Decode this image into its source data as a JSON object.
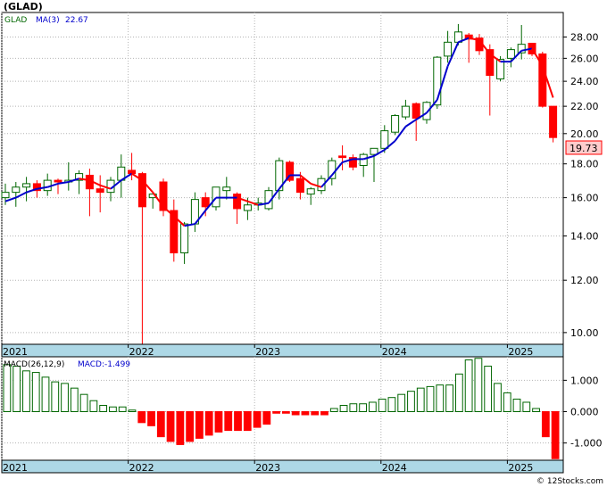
{
  "title": "(GLAD)",
  "credit": "© 12Stocks.com",
  "colors": {
    "up": "#006600",
    "down": "#ff0000",
    "ma_up": "#0000cc",
    "ma_down": "#ff0000",
    "axis_band": "#add8e6",
    "grid": "#b4b4b4"
  },
  "price_legend": {
    "symbol": "GLAD",
    "ma_label": "MA(3)",
    "ma_value": "22.67"
  },
  "last_price_label": "19.73",
  "macd_legend": {
    "label": "MACD(26,12,9)",
    "value_label": "MACD:-1.499"
  },
  "chart_data": [
    {
      "type": "candlestick",
      "scale": "log",
      "ylim": [
        9.6,
        30.5
      ],
      "yticks": [
        10,
        12,
        14,
        16,
        18,
        20,
        22,
        24,
        26,
        28
      ],
      "ytick_labels": [
        "10.00",
        "12.00",
        "14.00",
        "16.00",
        "18.00",
        "20.00",
        "22.00",
        "24.00",
        "26.00",
        "28.00"
      ],
      "x_labels": [
        {
          "text": "2021",
          "month": 0
        },
        {
          "text": "2022",
          "month": 12
        },
        {
          "text": "2023",
          "month": 24
        },
        {
          "text": "2024",
          "month": 36
        },
        {
          "text": "2025",
          "month": 48
        }
      ],
      "grid": true,
      "candles": [
        {
          "m": 0,
          "o": 16.0,
          "h": 16.8,
          "l": 15.6,
          "c": 16.3
        },
        {
          "m": 1,
          "o": 16.3,
          "h": 16.9,
          "l": 15.5,
          "c": 16.6
        },
        {
          "m": 2,
          "o": 16.6,
          "h": 17.2,
          "l": 15.8,
          "c": 16.8
        },
        {
          "m": 3,
          "o": 16.8,
          "h": 17.0,
          "l": 16.0,
          "c": 16.4
        },
        {
          "m": 4,
          "o": 16.4,
          "h": 17.4,
          "l": 16.1,
          "c": 17.0
        },
        {
          "m": 5,
          "o": 17.0,
          "h": 17.1,
          "l": 16.2,
          "c": 16.9
        },
        {
          "m": 6,
          "o": 16.9,
          "h": 18.1,
          "l": 16.4,
          "c": 17.0
        },
        {
          "m": 7,
          "o": 17.0,
          "h": 17.6,
          "l": 16.2,
          "c": 17.4
        },
        {
          "m": 8,
          "o": 17.3,
          "h": 17.7,
          "l": 15.0,
          "c": 16.5
        },
        {
          "m": 9,
          "o": 16.5,
          "h": 17.3,
          "l": 15.2,
          "c": 16.3
        },
        {
          "m": 10,
          "o": 16.3,
          "h": 17.2,
          "l": 15.8,
          "c": 17.0
        },
        {
          "m": 11,
          "o": 17.0,
          "h": 18.6,
          "l": 16.0,
          "c": 17.8
        },
        {
          "m": 12,
          "o": 17.6,
          "h": 18.7,
          "l": 17.0,
          "c": 17.4
        },
        {
          "m": 13,
          "o": 17.4,
          "h": 17.5,
          "l": 9.6,
          "c": 15.5
        },
        {
          "m": 14,
          "o": 16.0,
          "h": 16.2,
          "l": 15.4,
          "c": 16.2
        },
        {
          "m": 15,
          "o": 16.9,
          "h": 17.1,
          "l": 15.0,
          "c": 15.3
        },
        {
          "m": 16,
          "o": 15.3,
          "h": 15.9,
          "l": 12.8,
          "c": 13.2
        },
        {
          "m": 17,
          "o": 13.2,
          "h": 14.7,
          "l": 12.7,
          "c": 14.6
        },
        {
          "m": 18,
          "o": 14.6,
          "h": 16.3,
          "l": 14.2,
          "c": 15.9
        },
        {
          "m": 19,
          "o": 16.0,
          "h": 16.3,
          "l": 15.0,
          "c": 15.5
        },
        {
          "m": 20,
          "o": 15.5,
          "h": 16.6,
          "l": 15.3,
          "c": 16.6
        },
        {
          "m": 21,
          "o": 16.4,
          "h": 17.2,
          "l": 15.9,
          "c": 16.6
        },
        {
          "m": 22,
          "o": 16.2,
          "h": 16.3,
          "l": 14.6,
          "c": 15.4
        },
        {
          "m": 23,
          "o": 15.3,
          "h": 16.0,
          "l": 14.8,
          "c": 15.6
        },
        {
          "m": 24,
          "o": 15.6,
          "h": 16.0,
          "l": 15.3,
          "c": 15.7
        },
        {
          "m": 25,
          "o": 15.4,
          "h": 16.6,
          "l": 15.3,
          "c": 16.4
        },
        {
          "m": 26,
          "o": 16.4,
          "h": 18.4,
          "l": 15.9,
          "c": 18.2
        },
        {
          "m": 27,
          "o": 18.1,
          "h": 18.2,
          "l": 16.9,
          "c": 17.0
        },
        {
          "m": 28,
          "o": 17.1,
          "h": 17.5,
          "l": 15.9,
          "c": 16.3
        },
        {
          "m": 29,
          "o": 16.2,
          "h": 16.6,
          "l": 15.6,
          "c": 16.5
        },
        {
          "m": 30,
          "o": 16.4,
          "h": 17.3,
          "l": 16.2,
          "c": 17.1
        },
        {
          "m": 31,
          "o": 17.1,
          "h": 18.4,
          "l": 16.7,
          "c": 18.2
        },
        {
          "m": 32,
          "o": 18.5,
          "h": 19.2,
          "l": 17.6,
          "c": 18.4
        },
        {
          "m": 33,
          "o": 18.4,
          "h": 18.6,
          "l": 17.6,
          "c": 17.8
        },
        {
          "m": 34,
          "o": 17.9,
          "h": 18.7,
          "l": 17.2,
          "c": 18.6
        },
        {
          "m": 35,
          "o": 18.6,
          "h": 19.0,
          "l": 16.9,
          "c": 19.0
        },
        {
          "m": 36,
          "o": 19.0,
          "h": 20.6,
          "l": 18.7,
          "c": 20.2
        },
        {
          "m": 37,
          "o": 20.1,
          "h": 21.4,
          "l": 19.9,
          "c": 21.3
        },
        {
          "m": 38,
          "o": 21.2,
          "h": 22.5,
          "l": 21.0,
          "c": 22.0
        },
        {
          "m": 39,
          "o": 22.2,
          "h": 22.3,
          "l": 19.5,
          "c": 21.1
        },
        {
          "m": 40,
          "o": 21.0,
          "h": 22.4,
          "l": 20.7,
          "c": 22.3
        },
        {
          "m": 41,
          "o": 22.1,
          "h": 26.2,
          "l": 21.8,
          "c": 26.1
        },
        {
          "m": 42,
          "o": 26.2,
          "h": 28.6,
          "l": 25.6,
          "c": 27.5
        },
        {
          "m": 43,
          "o": 27.5,
          "h": 29.3,
          "l": 27.2,
          "c": 28.5
        },
        {
          "m": 44,
          "o": 28.2,
          "h": 28.4,
          "l": 25.6,
          "c": 27.8
        },
        {
          "m": 45,
          "o": 27.9,
          "h": 28.3,
          "l": 26.3,
          "c": 26.7
        },
        {
          "m": 46,
          "o": 26.8,
          "h": 27.3,
          "l": 21.3,
          "c": 24.5
        },
        {
          "m": 47,
          "o": 24.2,
          "h": 26.2,
          "l": 24.0,
          "c": 25.9
        },
        {
          "m": 48,
          "o": 26.0,
          "h": 27.0,
          "l": 25.2,
          "c": 26.8
        },
        {
          "m": 49,
          "o": 26.5,
          "h": 29.2,
          "l": 25.9,
          "c": 27.3
        },
        {
          "m": 50,
          "o": 27.4,
          "h": 27.4,
          "l": 26.2,
          "c": 26.4
        },
        {
          "m": 51,
          "o": 26.4,
          "h": 26.6,
          "l": 21.9,
          "c": 22.0
        },
        {
          "m": 52,
          "o": 22.0,
          "h": 22.0,
          "l": 19.4,
          "c": 19.73
        }
      ],
      "ma": [
        {
          "m": 0,
          "v": 15.8
        },
        {
          "m": 1,
          "v": 16.0
        },
        {
          "m": 2,
          "v": 16.3
        },
        {
          "m": 3,
          "v": 16.5
        },
        {
          "m": 4,
          "v": 16.6
        },
        {
          "m": 5,
          "v": 16.8
        },
        {
          "m": 6,
          "v": 16.9
        },
        {
          "m": 7,
          "v": 17.1
        },
        {
          "m": 8,
          "v": 17.0
        },
        {
          "m": 9,
          "v": 16.7
        },
        {
          "m": 10,
          "v": 16.5
        },
        {
          "m": 11,
          "v": 17.0
        },
        {
          "m": 12,
          "v": 17.4
        },
        {
          "m": 13,
          "v": 17.0
        },
        {
          "m": 14,
          "v": 16.3
        },
        {
          "m": 15,
          "v": 15.5
        },
        {
          "m": 16,
          "v": 15.0
        },
        {
          "m": 17,
          "v": 14.5
        },
        {
          "m": 18,
          "v": 14.6
        },
        {
          "m": 19,
          "v": 15.3
        },
        {
          "m": 20,
          "v": 16.0
        },
        {
          "m": 21,
          "v": 16.0
        },
        {
          "m": 22,
          "v": 16.0
        },
        {
          "m": 23,
          "v": 15.8
        },
        {
          "m": 24,
          "v": 15.6
        },
        {
          "m": 25,
          "v": 15.7
        },
        {
          "m": 26,
          "v": 16.5
        },
        {
          "m": 27,
          "v": 17.3
        },
        {
          "m": 28,
          "v": 17.3
        },
        {
          "m": 29,
          "v": 16.8
        },
        {
          "m": 30,
          "v": 16.6
        },
        {
          "m": 31,
          "v": 17.3
        },
        {
          "m": 32,
          "v": 18.1
        },
        {
          "m": 33,
          "v": 18.3
        },
        {
          "m": 34,
          "v": 18.3
        },
        {
          "m": 35,
          "v": 18.5
        },
        {
          "m": 36,
          "v": 18.9
        },
        {
          "m": 37,
          "v": 19.5
        },
        {
          "m": 38,
          "v": 20.5
        },
        {
          "m": 39,
          "v": 21.0
        },
        {
          "m": 40,
          "v": 21.5
        },
        {
          "m": 41,
          "v": 22.5
        },
        {
          "m": 42,
          "v": 25.3
        },
        {
          "m": 43,
          "v": 27.5
        },
        {
          "m": 44,
          "v": 27.9
        },
        {
          "m": 45,
          "v": 27.7
        },
        {
          "m": 46,
          "v": 26.4
        },
        {
          "m": 47,
          "v": 25.7
        },
        {
          "m": 48,
          "v": 25.7
        },
        {
          "m": 49,
          "v": 26.7
        },
        {
          "m": 50,
          "v": 26.9
        },
        {
          "m": 51,
          "v": 25.3
        },
        {
          "m": 52,
          "v": 22.67
        }
      ]
    },
    {
      "type": "bar",
      "name": "MACD(26,12,9)",
      "ylim": [
        -1.55,
        1.75
      ],
      "yticks": [
        1.0,
        0.0,
        -1.0
      ],
      "ytick_labels": [
        "1.000",
        "0.000",
        "-1.000"
      ],
      "x_labels": [
        {
          "text": "2021",
          "month": 0
        },
        {
          "text": "2022",
          "month": 12
        },
        {
          "text": "2023",
          "month": 24
        },
        {
          "text": "2024",
          "month": 36
        },
        {
          "text": "2025",
          "month": 48
        }
      ],
      "grid": true,
      "values": [
        1.5,
        1.45,
        1.3,
        1.25,
        1.1,
        0.95,
        0.9,
        0.75,
        0.55,
        0.35,
        0.2,
        0.15,
        0.15,
        0.05,
        -0.35,
        -0.45,
        -0.8,
        -0.95,
        -1.05,
        -0.95,
        -0.85,
        -0.75,
        -0.65,
        -0.6,
        -0.6,
        -0.6,
        -0.5,
        -0.4,
        -0.05,
        -0.05,
        -0.1,
        -0.1,
        -0.1,
        -0.1,
        0.1,
        0.2,
        0.25,
        0.25,
        0.3,
        0.4,
        0.45,
        0.55,
        0.65,
        0.75,
        0.8,
        0.85,
        0.85,
        1.2,
        1.65,
        1.7,
        1.45,
        0.9,
        0.6,
        0.4,
        0.3,
        0.1,
        -0.8,
        -1.5
      ]
    }
  ]
}
